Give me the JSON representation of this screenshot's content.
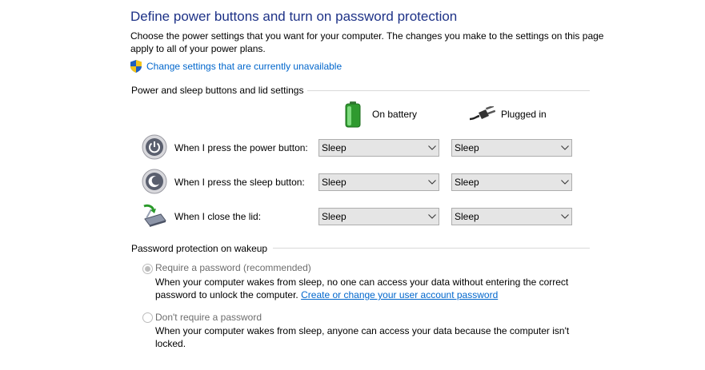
{
  "page": {
    "title": "Define power buttons and turn on password protection",
    "description": "Choose the power settings that you want for your computer. The changes you make to the settings on this page apply to all of your power plans.",
    "change_link": "Change settings that are currently unavailable"
  },
  "buttons_section": {
    "label": "Power and sleep buttons and lid settings",
    "columns": {
      "on_battery": "On battery",
      "plugged_in": "Plugged in"
    },
    "rows": [
      {
        "label": "When I press the power button:",
        "on_battery": "Sleep",
        "plugged_in": "Sleep"
      },
      {
        "label": "When I press the sleep button:",
        "on_battery": "Sleep",
        "plugged_in": "Sleep"
      },
      {
        "label": "When I close the lid:",
        "on_battery": "Sleep",
        "plugged_in": "Sleep"
      }
    ]
  },
  "password_section": {
    "label": "Password protection on wakeup",
    "require": {
      "label": "Require a password (recommended)",
      "desc_before_link": "When your computer wakes from sleep, no one can access your data without entering the correct password to unlock the computer.",
      "link": "Create or change your user account password",
      "selected": true
    },
    "dont_require": {
      "label": "Don't require a password",
      "desc": "When your computer wakes from sleep, anyone can access your data because the computer isn't locked.",
      "selected": false
    }
  },
  "colors": {
    "title": "#1e3287",
    "link": "#0066cc",
    "disabled_text": "#6d6d6d"
  },
  "icons": [
    "uac-shield-icon",
    "battery-icon",
    "power-plug-icon",
    "power-button-icon",
    "sleep-button-icon",
    "laptop-lid-icon",
    "chevron-down-icon"
  ]
}
